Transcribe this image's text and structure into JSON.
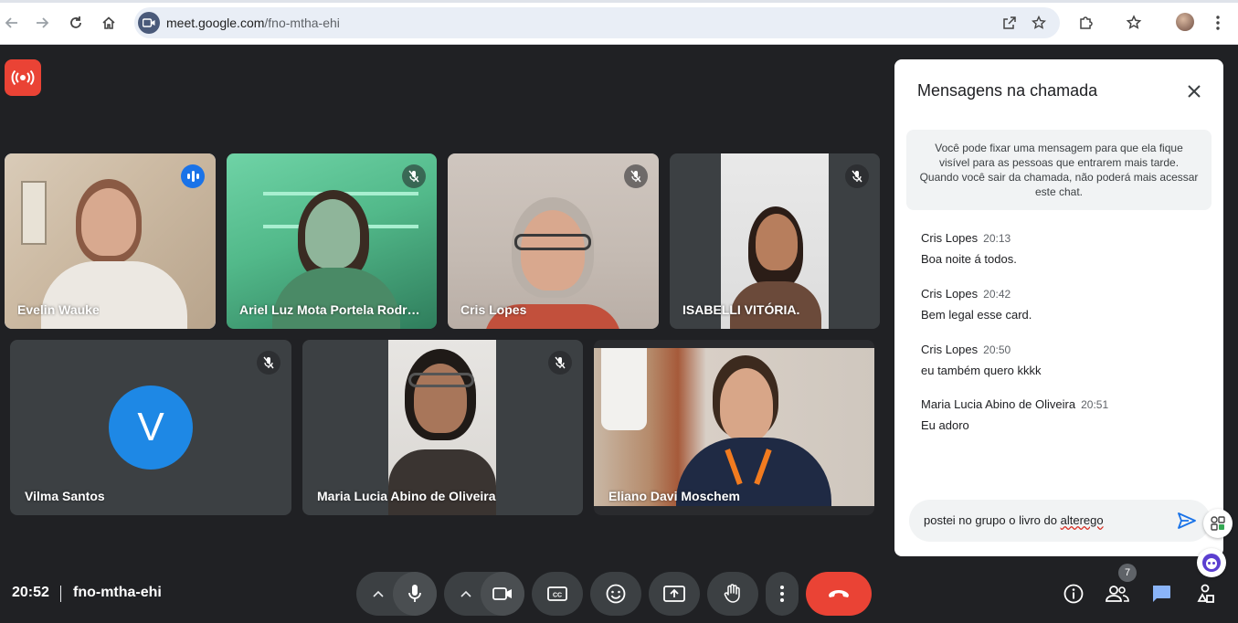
{
  "browser": {
    "url_host": "meet.google.com",
    "url_path": "/fno-mtha-ehi"
  },
  "participants": [
    {
      "name": "Evelin Wauke",
      "state": "speaking"
    },
    {
      "name": "Ariel Luz Mota Portela Rodri…",
      "state": "muted"
    },
    {
      "name": "Cris Lopes",
      "state": "muted"
    },
    {
      "name": "ISABELLI VITÓRIA.",
      "state": "muted"
    },
    {
      "name": "Vilma Santos",
      "state": "muted",
      "avatar_letter": "V"
    },
    {
      "name": "Maria Lucia Abino de Oliveira",
      "state": "muted"
    },
    {
      "name": "Eliano Davi Moschem",
      "state": "video"
    }
  ],
  "chat": {
    "title": "Mensagens na chamada",
    "info": "Você pode fixar uma mensagem para que ela fique visível para as pessoas que entrarem mais tarde. Quando você sair da chamada, não poderá mais acessar este chat.",
    "messages": [
      {
        "sender": "Cris Lopes",
        "time": "20:13",
        "text": "Boa noite á todos."
      },
      {
        "sender": "Cris Lopes",
        "time": "20:42",
        "text": "Bem legal esse card."
      },
      {
        "sender": "Cris Lopes",
        "time": "20:50",
        "text": "eu também quero kkkk"
      },
      {
        "sender": "Maria Lucia Abino de Oliveira",
        "time": "20:51",
        "text": "Eu adoro"
      }
    ],
    "input_value_pre": "postei no grupo o livro do ",
    "input_value_word": "alterego"
  },
  "bottom": {
    "clock": "20:52",
    "meeting_code": "fno-mtha-ehi",
    "people_count": "7"
  },
  "colors": {
    "accent": "#1a73e8",
    "end_call": "#ea4335",
    "live_badge": "#ea4335",
    "background": "#202124"
  }
}
